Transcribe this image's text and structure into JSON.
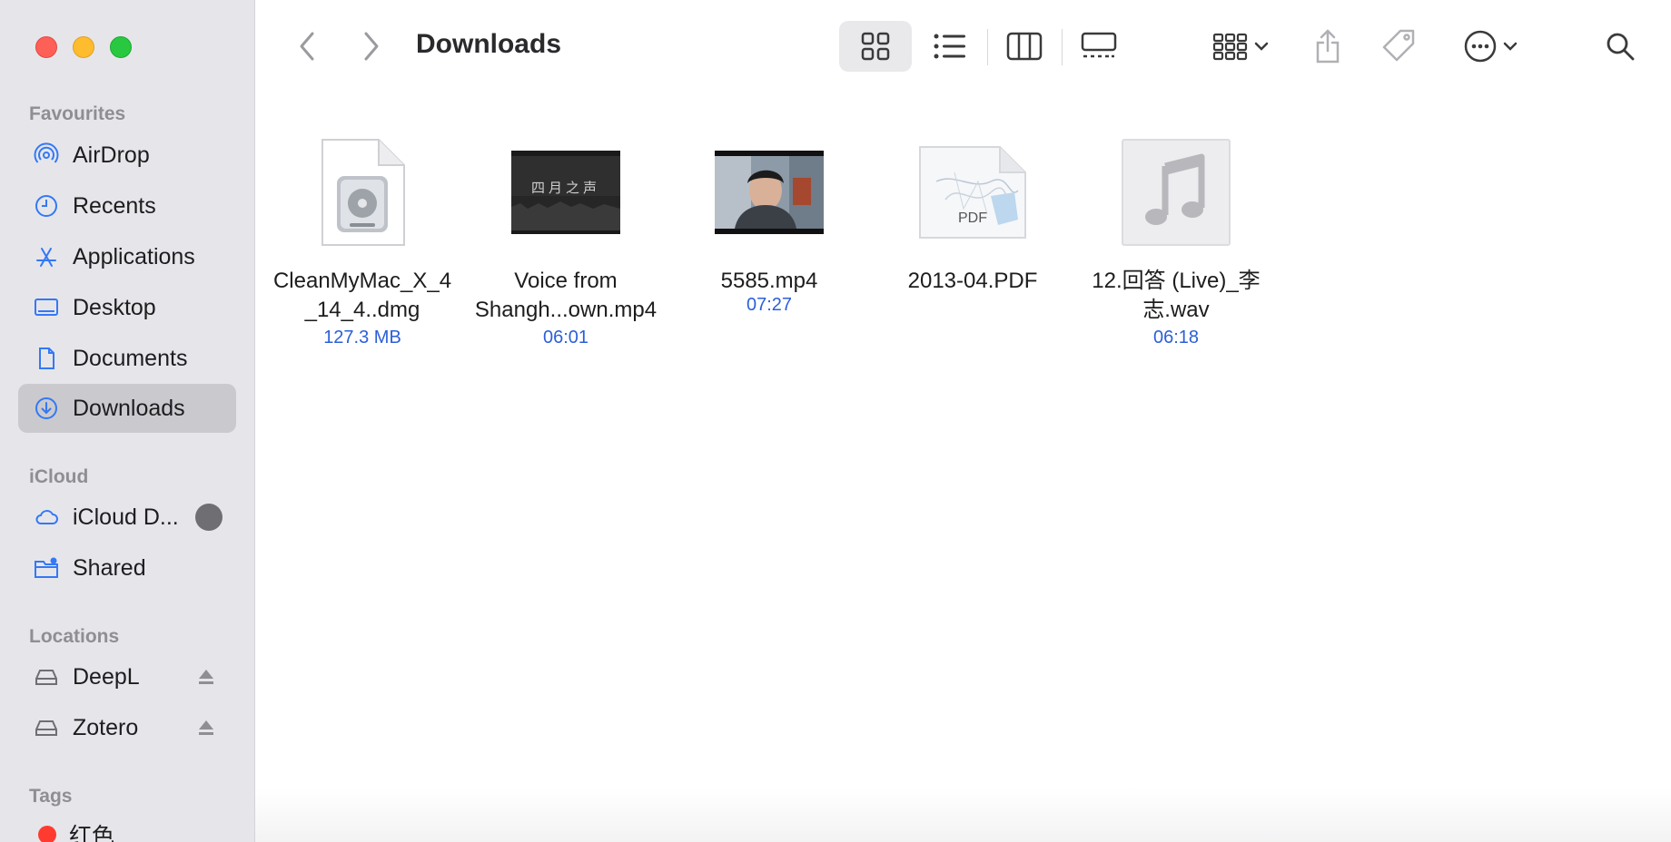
{
  "window": {
    "title": "Downloads"
  },
  "sidebar": {
    "favourites_title": "Favourites",
    "favourites": [
      {
        "label": "AirDrop",
        "icon": "airdrop-icon"
      },
      {
        "label": "Recents",
        "icon": "clock-icon"
      },
      {
        "label": "Applications",
        "icon": "applications-icon"
      },
      {
        "label": "Desktop",
        "icon": "desktop-icon"
      },
      {
        "label": "Documents",
        "icon": "document-icon"
      },
      {
        "label": "Downloads",
        "icon": "download-icon",
        "selected": true
      }
    ],
    "icloud_title": "iCloud",
    "icloud": [
      {
        "label": "iCloud D...",
        "icon": "cloud-icon"
      },
      {
        "label": "Shared",
        "icon": "shared-folder-icon"
      }
    ],
    "locations_title": "Locations",
    "locations": [
      {
        "label": "DeepL",
        "icon": "drive-icon"
      },
      {
        "label": "Zotero",
        "icon": "drive-icon"
      }
    ],
    "tags_title": "Tags",
    "tags": [
      {
        "label": "红色",
        "color": "#ff3b30"
      }
    ]
  },
  "files": [
    {
      "name": "CleanMyMac_X_4_14_4..dmg",
      "line1": "CleanMyMac_X_4",
      "line2": "_14_4..dmg",
      "meta": "127.3 MB",
      "icon": "disk-image-icon"
    },
    {
      "name": "Voice from Shangh...own.mp4",
      "line1": "Voice from",
      "line2": "Shangh...own.mp4",
      "meta": "06:01",
      "icon": "video-thumbnail",
      "thumb_text": "四月之声"
    },
    {
      "name": "5585.mp4",
      "line1": "5585.mp4",
      "line2": "",
      "meta": "07:27",
      "icon": "video-thumbnail"
    },
    {
      "name": "2013-04.PDF",
      "line1": "2013-04.PDF",
      "line2": "",
      "meta": "",
      "icon": "pdf-icon",
      "badge": "PDF"
    },
    {
      "name": "12.回答 (Live)_李志.wav",
      "line1": "12.回答 (Live)_李",
      "line2": "志.wav",
      "meta": "06:18",
      "icon": "music-note-icon"
    }
  ],
  "colors": {
    "accent": "#2b5fd9",
    "sidebar_bg": "#e6e6ea",
    "selected_bg": "#cacace",
    "icon_blue": "#3478f6"
  }
}
